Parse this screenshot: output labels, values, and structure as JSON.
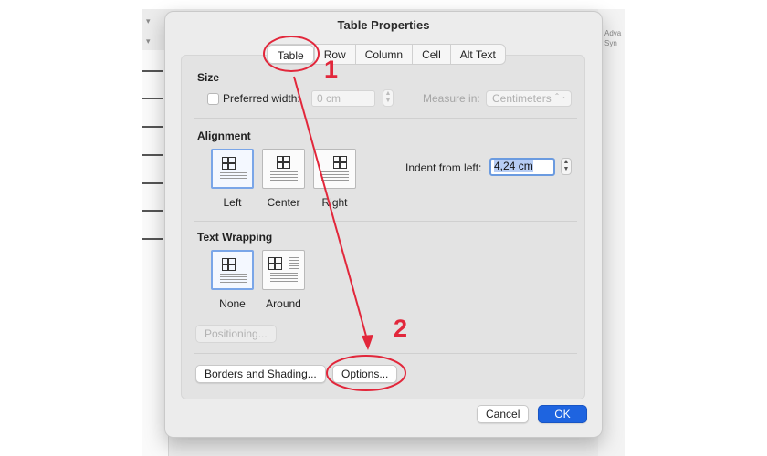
{
  "background": {
    "right_text_1": "Adva",
    "right_text_2": "Syn"
  },
  "dialog": {
    "title": "Table Properties",
    "tabs": [
      {
        "label": "Table",
        "active": true
      },
      {
        "label": "Row"
      },
      {
        "label": "Column"
      },
      {
        "label": "Cell"
      },
      {
        "label": "Alt Text"
      }
    ],
    "size": {
      "section_title": "Size",
      "preferred_width_label": "Preferred width:",
      "preferred_width_checked": false,
      "preferred_width_value": "0 cm",
      "measure_in_label": "Measure in:",
      "measure_in_value": "Centimeters"
    },
    "alignment": {
      "section_title": "Alignment",
      "options": [
        {
          "label": "Left",
          "selected": true
        },
        {
          "label": "Center"
        },
        {
          "label": "Right"
        }
      ],
      "indent_label": "Indent from left:",
      "indent_value": "4,24 cm"
    },
    "text_wrapping": {
      "section_title": "Text Wrapping",
      "options": [
        {
          "label": "None",
          "selected": true
        },
        {
          "label": "Around"
        }
      ],
      "positioning_button": "Positioning..."
    },
    "borders_button": "Borders and Shading...",
    "options_button": "Options...",
    "cancel_button": "Cancel",
    "ok_button": "OK"
  },
  "annotations": {
    "step_1": "1",
    "step_2": "2",
    "color": "#e2273b"
  },
  "colors": {
    "accent": "#1e64e0",
    "selection": "#7aa6e8"
  }
}
